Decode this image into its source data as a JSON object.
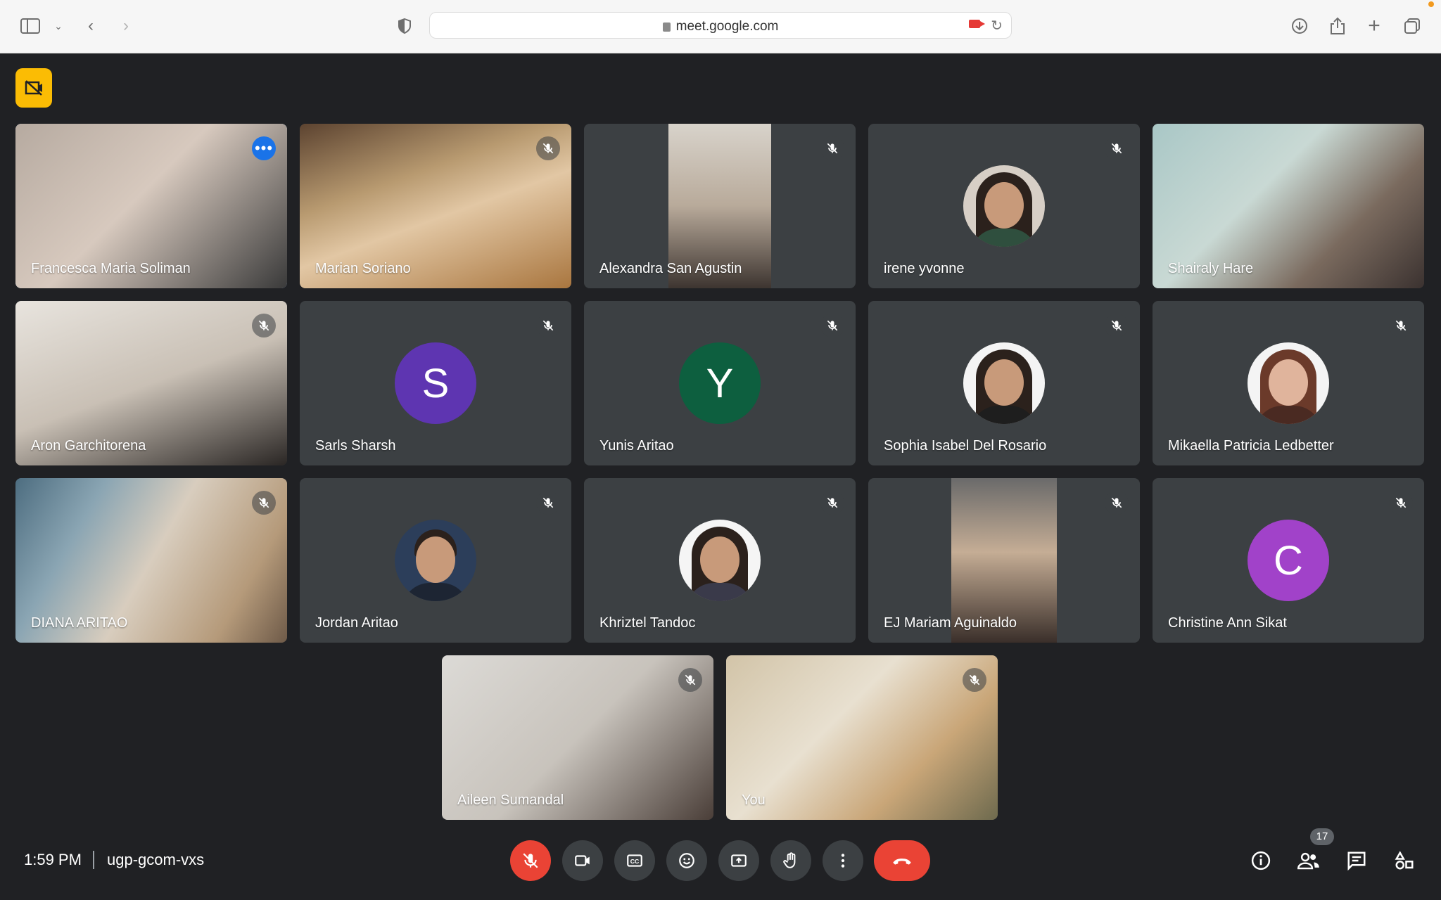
{
  "browser": {
    "url": "meet.google.com"
  },
  "meeting": {
    "time": "1:59 PM",
    "code": "ugp-gcom-vxs",
    "participant_count": "17"
  },
  "participants": [
    {
      "name": "Francesca Maria Soliman",
      "active": true
    },
    {
      "name": "Marian Soriano"
    },
    {
      "name": "Alexandra San Agustin"
    },
    {
      "name": "irene yvonne"
    },
    {
      "name": "Shairaly Hare"
    },
    {
      "name": "Aron Garchitorena"
    },
    {
      "name": "Sarls Sharsh",
      "initial": "S",
      "color": "#5e35b1"
    },
    {
      "name": "Yunis Aritao",
      "initial": "Y",
      "color": "#0d5f3f"
    },
    {
      "name": "Sophia Isabel Del Rosario"
    },
    {
      "name": "Mikaella Patricia Ledbetter"
    },
    {
      "name": "DIANA ARITAO"
    },
    {
      "name": "Jordan Aritao"
    },
    {
      "name": "Khriztel Tandoc"
    },
    {
      "name": "EJ Mariam Aguinaldo"
    },
    {
      "name": "Christine Ann Sikat",
      "initial": "C",
      "color": "#a142c9"
    },
    {
      "name": "Aileen Sumandal"
    },
    {
      "name": "You"
    }
  ]
}
